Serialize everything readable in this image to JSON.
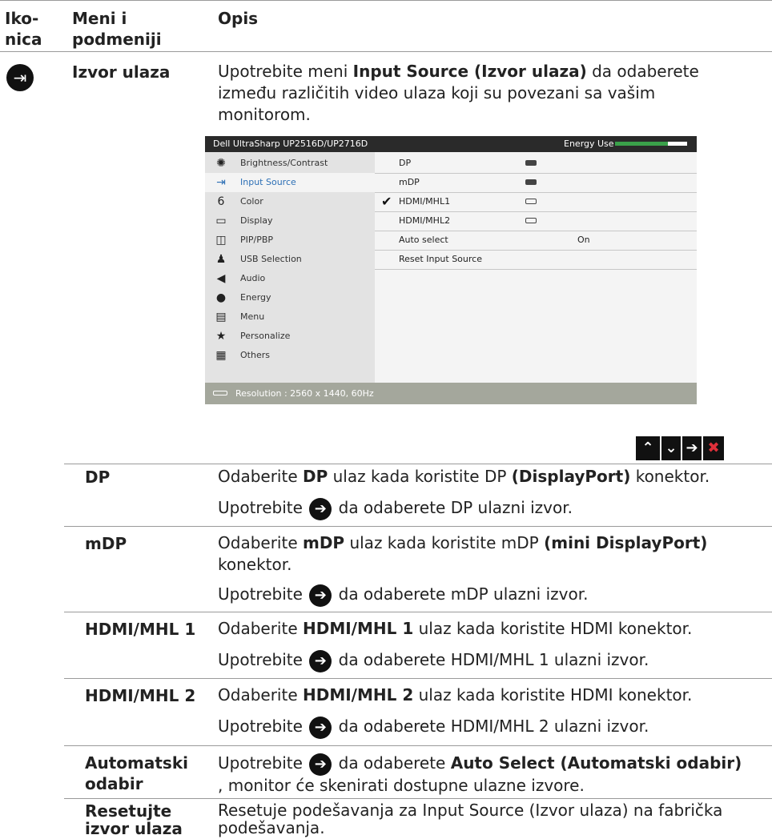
{
  "header": {
    "col1": "Iko-\nnica",
    "col2": "Meni i\npodmeniji",
    "col3": "Opis"
  },
  "main_item": {
    "icon": "input-source-icon",
    "title": "Izvor ulaza",
    "desc_pre": "Upotrebite meni ",
    "desc_bold": "Input Source (Izvor ulaza)",
    "desc_post": " da odaberete između različitih video ulaza koji su povezani sa vašim monitorom."
  },
  "osd": {
    "title": "Dell UltraSharp UP2516D/UP2716D",
    "energy_label": "Energy Use",
    "energy_level": 0.73,
    "menu": [
      {
        "icon": "brightness-icon",
        "glyph": "✺",
        "label": "Brightness/Contrast",
        "selected": false
      },
      {
        "icon": "input-source-icon",
        "glyph": "⇥",
        "label": "Input Source",
        "selected": true
      },
      {
        "icon": "color-icon",
        "glyph": "6",
        "label": "Color",
        "selected": false
      },
      {
        "icon": "display-icon",
        "glyph": "▭",
        "label": "Display",
        "selected": false
      },
      {
        "icon": "pip-pbp-icon",
        "glyph": "◫",
        "label": "PIP/PBP",
        "selected": false
      },
      {
        "icon": "usb-icon",
        "glyph": "♟",
        "label": "USB Selection",
        "selected": false
      },
      {
        "icon": "audio-icon",
        "glyph": "◀",
        "label": "Audio",
        "selected": false
      },
      {
        "icon": "energy-icon",
        "glyph": "●",
        "label": "Energy",
        "selected": false
      },
      {
        "icon": "menu-icon",
        "glyph": "▤",
        "label": "Menu",
        "selected": false
      },
      {
        "icon": "star-icon",
        "glyph": "★",
        "label": "Personalize",
        "selected": false
      },
      {
        "icon": "others-icon",
        "glyph": "▦",
        "label": "Others",
        "selected": false
      }
    ],
    "options": [
      {
        "label": "DP",
        "check": false,
        "port": true,
        "filled": true,
        "value": ""
      },
      {
        "label": "mDP",
        "check": false,
        "port": true,
        "filled": true,
        "value": ""
      },
      {
        "label": "HDMI/MHL1",
        "check": true,
        "port": true,
        "filled": false,
        "value": ""
      },
      {
        "label": "HDMI/MHL2",
        "check": false,
        "port": true,
        "filled": false,
        "value": ""
      },
      {
        "label": "Auto select",
        "check": false,
        "port": false,
        "filled": false,
        "value": "On"
      },
      {
        "label": "Reset Input Source",
        "check": false,
        "port": false,
        "filled": false,
        "value": ""
      }
    ],
    "footer": "Resolution : 2560 x 1440, 60Hz"
  },
  "nav_buttons": [
    {
      "icon": "up-icon",
      "glyph": "⌃",
      "color": "#ffffff"
    },
    {
      "icon": "down-icon",
      "glyph": "⌄",
      "color": "#ffffff"
    },
    {
      "icon": "right-arrow-icon",
      "glyph": "➔",
      "color": "#ffffff"
    },
    {
      "icon": "close-icon",
      "glyph": "✖",
      "color": "#e0303a"
    }
  ],
  "use_word": "Upotrebite",
  "rows": [
    {
      "name": "DP",
      "d1_pre": "Odaberite ",
      "d1_bold": "DP",
      "d1_mid": " ulaz kada koristite DP ",
      "d1_bold2": "(DisplayPort)",
      "d1_post": " konektor.",
      "d2_post": "da odaberete DP ulazni izvor."
    },
    {
      "name": "mDP",
      "d1_pre": "Odaberite ",
      "d1_bold": "mDP",
      "d1_mid": " ulaz kada koristite mDP ",
      "d1_bold2": "(mini DisplayPort)",
      "d1_post": " konektor.",
      "d2_post": "da odaberete mDP ulazni izvor."
    },
    {
      "name": "HDMI/MHL 1",
      "d1_pre": "Odaberite ",
      "d1_bold": "HDMI/MHL 1",
      "d1_mid": " ulaz kada koristite HDMI konektor.",
      "d1_bold2": "",
      "d1_post": "",
      "d2_post": "da odaberete HDMI/MHL 1 ulazni izvor."
    },
    {
      "name": "HDMI/MHL 2",
      "d1_pre": "Odaberite ",
      "d1_bold": "HDMI/MHL 2",
      "d1_mid": " ulaz kada koristite HDMI konektor.",
      "d1_bold2": "",
      "d1_post": "",
      "d2_post": "da odaberete HDMI/MHL 2 ulazni izvor."
    }
  ],
  "auto": {
    "name1": "Automatski",
    "name2": "odabir",
    "post_pre": " da odaberete ",
    "bold": "Auto Select (Automatski odabir)",
    "line2": ", monitor će skenirati dostupne ulazne izvore."
  },
  "reset": {
    "name1": "Resetujte",
    "name2": "izvor ulaza",
    "line1": "Resetuje podešavanja za Input Source (Izvor ulaza) na fabrička",
    "line2": "podešavanja."
  }
}
